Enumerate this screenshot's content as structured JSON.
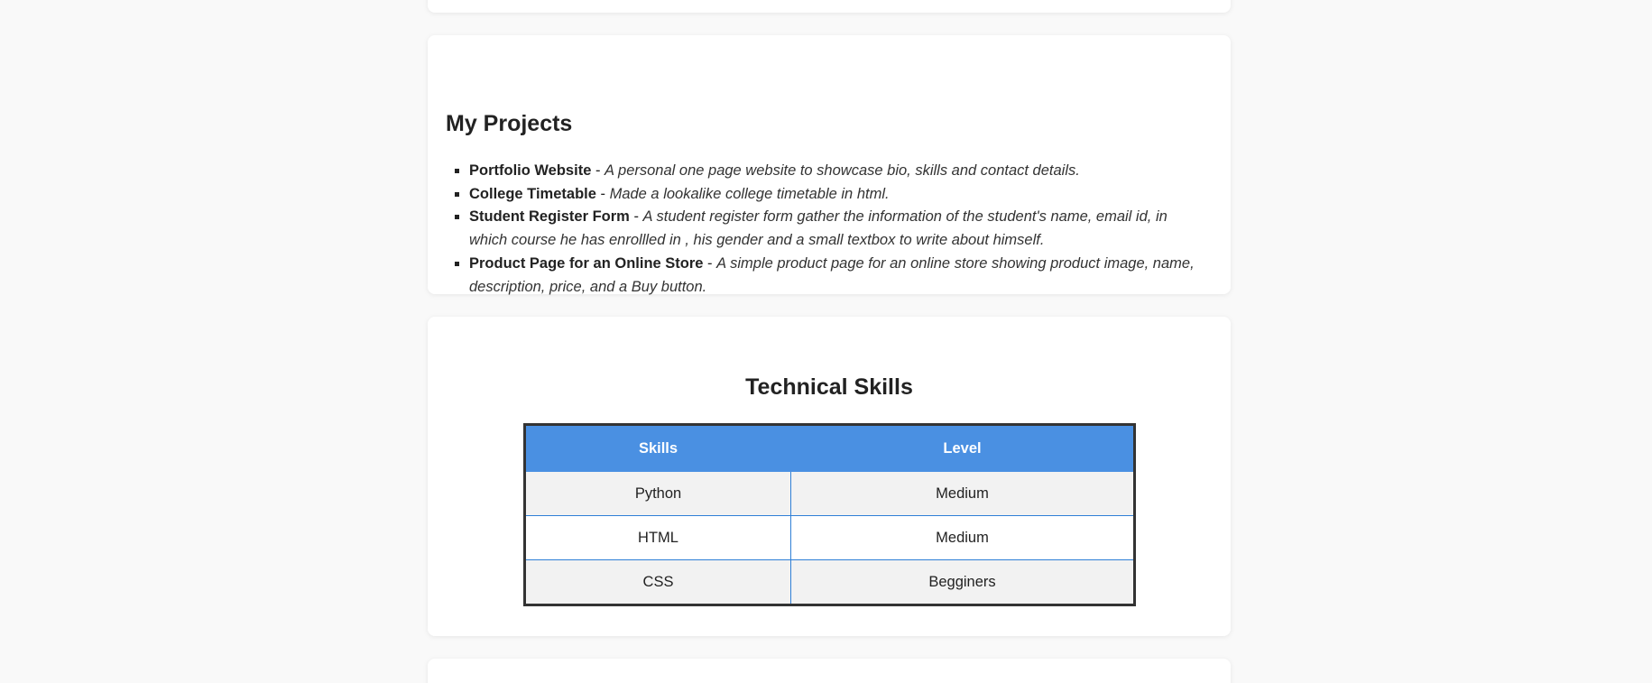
{
  "projects": {
    "title": "My Projects",
    "items": [
      {
        "name": "Portfolio Website",
        "separator": " - ",
        "description": "A personal one page website to showcase bio, skills and contact details."
      },
      {
        "name": "College Timetable",
        "separator": " - ",
        "description": "Made a lookalike college timetable in html."
      },
      {
        "name": "Student Register Form",
        "separator": " - ",
        "description": "A student register form gather the information of the student's name, email id, in which course he has enrollled in , his gender and a small textbox to write about himself."
      },
      {
        "name": "Product Page for an Online Store",
        "separator": " - ",
        "description": "A simple product page for an online store showing product image, name, description, price, and a Buy button."
      }
    ]
  },
  "skills": {
    "title": "Technical Skills",
    "headers": [
      "Skills",
      "Level"
    ],
    "rows": [
      [
        "Python",
        "Medium"
      ],
      [
        "HTML",
        "Medium"
      ],
      [
        "CSS",
        "Begginers"
      ]
    ]
  },
  "colors": {
    "accent": "#4a90e2",
    "table_border": "#333333",
    "cell_border": "#2f7fd6",
    "stripe": "#f2f2f2",
    "page_bg": "#f9f9f9",
    "card_bg": "#ffffff"
  }
}
